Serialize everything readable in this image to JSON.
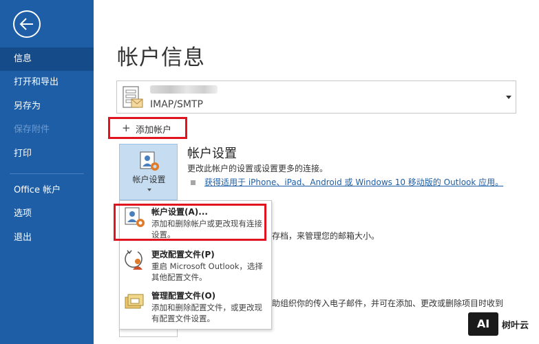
{
  "sidebar": {
    "items": [
      {
        "label": "信息"
      },
      {
        "label": "打开和导出"
      },
      {
        "label": "另存为"
      },
      {
        "label": "保存附件"
      },
      {
        "label": "打印"
      },
      {
        "label": "Office 帐户"
      },
      {
        "label": "选项"
      },
      {
        "label": "退出"
      }
    ]
  },
  "main": {
    "title": "帐户信息",
    "account": {
      "type": "IMAP/SMTP"
    },
    "add_account_label": "添加帐户",
    "settings_tile_label": "帐户设置",
    "section": {
      "title": "帐户设置",
      "description": "更改此帐户的设置或设置更多的连接。",
      "link": "获得适用于 iPhone、iPad、Android 或 Windows 10 移动版的 Outlook 应用。"
    },
    "background_text_1": "存档，来管理您的邮箱大小。",
    "background_text_2": "助组织你的传入电子邮件，并可在添加、更改或删除项目时收到"
  },
  "menu": {
    "items": [
      {
        "title": "帐户设置(A)...",
        "description": "添加和删除帐户或更改现有连接设置。"
      },
      {
        "title": "更改配置文件(P)",
        "description": "重启 Microsoft Outlook，选择其他配置文件。"
      },
      {
        "title": "管理配置文件(O)",
        "description": "添加和删除配置文件，或更改现有配置文件设置。"
      }
    ]
  },
  "watermark": {
    "logo": "AI",
    "text": "树叶云"
  },
  "colors": {
    "sidebar": "#1e5ea6",
    "highlight": "#e0141e",
    "link": "#1e5ea6"
  }
}
